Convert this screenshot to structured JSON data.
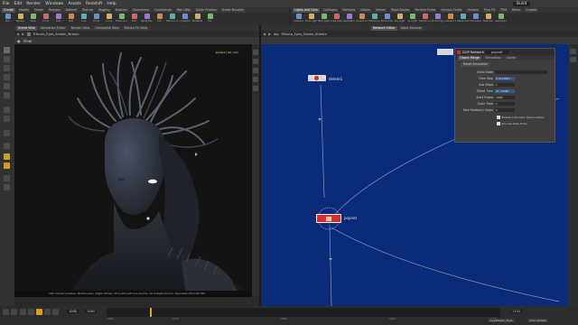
{
  "menubar": [
    "File",
    "Edit",
    "Render",
    "Windows",
    "Assets",
    "Redshift",
    "Help"
  ],
  "desktop": "Build",
  "shelf_tabs_left": [
    "Create",
    "Modify",
    "Model",
    "Polygon",
    "Deform",
    "Texture",
    "Rigging",
    "Muscles",
    "Characters",
    "Constraints",
    "Hair Utils",
    "Guide Process",
    "Guide Brushes",
    "Terrain FX",
    "Simple FX",
    "Volume",
    "Cloud FX",
    "Redshift"
  ],
  "shelf_tabs_right": [
    "Lights and Cam",
    "Collisions",
    "Particles",
    "Grains",
    "Vellum",
    "Rigid Bodies",
    "Particle Fluids",
    "Viscous Fluids",
    "Oceans",
    "Pyro FX",
    "FEM",
    "Wires",
    "Crowds",
    "Drive Simulation"
  ],
  "shelf_tools_left": [
    "Box",
    "Sphere",
    "Tube",
    "Torus",
    "Grid",
    "Null",
    "Line",
    "Circle",
    "Curve",
    "Draw Curve",
    "Path",
    "Spray Paint",
    "Font",
    "Platonic Solids",
    "L-System",
    "Metaball",
    "File"
  ],
  "shelf_tools_right": [
    "Camera",
    "Point Light",
    "Spot Light",
    "Area Light",
    "Geometry Light",
    "Volume Light",
    "Distant Light",
    "Environment Light",
    "Sky Light",
    "GI Light",
    "Caustic Light",
    "Portal Light",
    "Ambient Light",
    "Stereo Camera",
    "VR Camera",
    "Switcher",
    "Gamepad Camera"
  ],
  "viewport": {
    "tabs": [
      "Scene View",
      "Animation Editor",
      "Render View",
      "Composite View",
      "Motion FX View"
    ],
    "path": "Ritsuto_Eyes_Smoke_Stream",
    "view_label": "View",
    "camera": "persp1 | No cam",
    "status": "Left mouse tumbles. Middle pans. Right dollies. Ctrl+Alt+Left box-zooms. Ctrl+Right zooms. Spacebar-Ctrl-Left tilts."
  },
  "network": {
    "tabs": [
      "Network Editor",
      "Asset Browser"
    ],
    "path": "Ritsuto_Eyes_Smoke_Stream",
    "obj_label": "obj",
    "nodes": [
      {
        "name": "delete1",
        "kind": "sop"
      },
      {
        "name": "popnet",
        "kind": "dop"
      }
    ]
  },
  "params": {
    "header_type": "DOP Network",
    "header_name": "popnet",
    "tabs": [
      "Object Merge",
      "Simulation",
      "Cache"
    ],
    "section": "Reset Simulation",
    "rows": [
      {
        "label": "Initial State",
        "value": ""
      },
      {
        "label": "Time Step",
        "value": "0.0416667"
      },
      {
        "label": "Sub Steps",
        "value": "1"
      },
      {
        "label": "Offset Time",
        "value": "$T_START"
      },
      {
        "label": "Start Frame",
        "value": "1064"
      },
      {
        "label": "Scale Time",
        "value": "1"
      },
      {
        "label": "Max Feedback Loops",
        "value": "2"
      }
    ],
    "checks": [
      {
        "label": "Enable Automatic Resimulation",
        "checked": true
      },
      {
        "label": "Provide Data Hints",
        "checked": true
      }
    ]
  },
  "timeline": {
    "current_frame": "1068",
    "start_frame": "1064",
    "end_frame": "1100",
    "ticks": [
      "1064",
      "1070",
      "1080",
      "1090",
      "1100"
    ],
    "object": "/obj/Ritsuto_Eyes",
    "mode": "Auto Update"
  },
  "colors": {
    "network_bg": "#0a2a7a",
    "accent": "#e8a020",
    "node_red": "#d43030"
  }
}
